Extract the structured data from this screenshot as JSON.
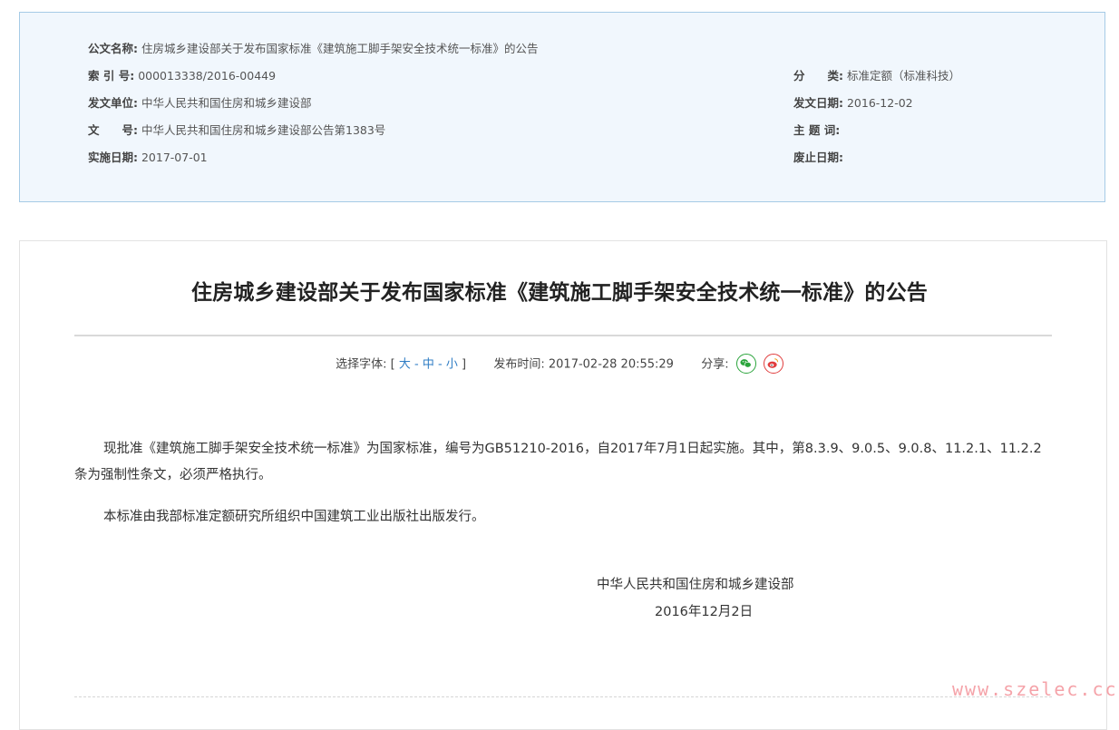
{
  "info": {
    "doc_name": {
      "label": "公文名称:",
      "value": "住房城乡建设部关于发布国家标准《建筑施工脚手架安全技术统一标准》的公告"
    },
    "index_no": {
      "label": "索 引 号:",
      "value": "000013338/2016-00449"
    },
    "category": {
      "label": "分　　类:",
      "value": "标准定额（标准科技）"
    },
    "issuer": {
      "label": "发文单位:",
      "value": "中华人民共和国住房和城乡建设部"
    },
    "issue_date": {
      "label": "发文日期:",
      "value": "2016-12-02"
    },
    "doc_no": {
      "label": "文　　号:",
      "value": "中华人民共和国住房和城乡建设部公告第1383号"
    },
    "keywords": {
      "label": "主 题 词:",
      "value": ""
    },
    "impl_date": {
      "label": "实施日期:",
      "value": "2017-07-01"
    },
    "abolish_date": {
      "label": "废止日期:",
      "value": ""
    }
  },
  "article": {
    "title": "住房城乡建设部关于发布国家标准《建筑施工脚手架安全技术统一标准》的公告",
    "font_label": "选择字体:",
    "bracket_open": "[",
    "font_large": "大",
    "font_medium": "中",
    "font_small": "小",
    "sep": "-",
    "bracket_close": "]",
    "publish_label": "发布时间:",
    "publish_time": "2017-02-28 20:55:29",
    "share_label": "分享:",
    "paragraph1": "现批准《建筑施工脚手架安全技术统一标准》为国家标准，编号为GB51210-2016，自2017年7月1日起实施。其中，第8.3.9、9.0.5、9.0.8、11.2.1、11.2.2条为强制性条文，必须严格执行。",
    "paragraph2": "本标准由我部标准定额研究所组织中国建筑工业出版社出版发行。",
    "signature_org": "中华人民共和国住房和城乡建设部",
    "signature_date": "2016年12月2日"
  },
  "watermark": "www.szelec.cc",
  "colors": {
    "info_bg": "#f1f7fd",
    "info_border": "#a6cbe6",
    "link_blue": "#2e7cc4",
    "wechat_green": "#2aa43b",
    "weibo_red": "#e03c3c",
    "watermark_pink": "#f5a3a9"
  },
  "icons": [
    "wechat-icon",
    "weibo-icon"
  ]
}
